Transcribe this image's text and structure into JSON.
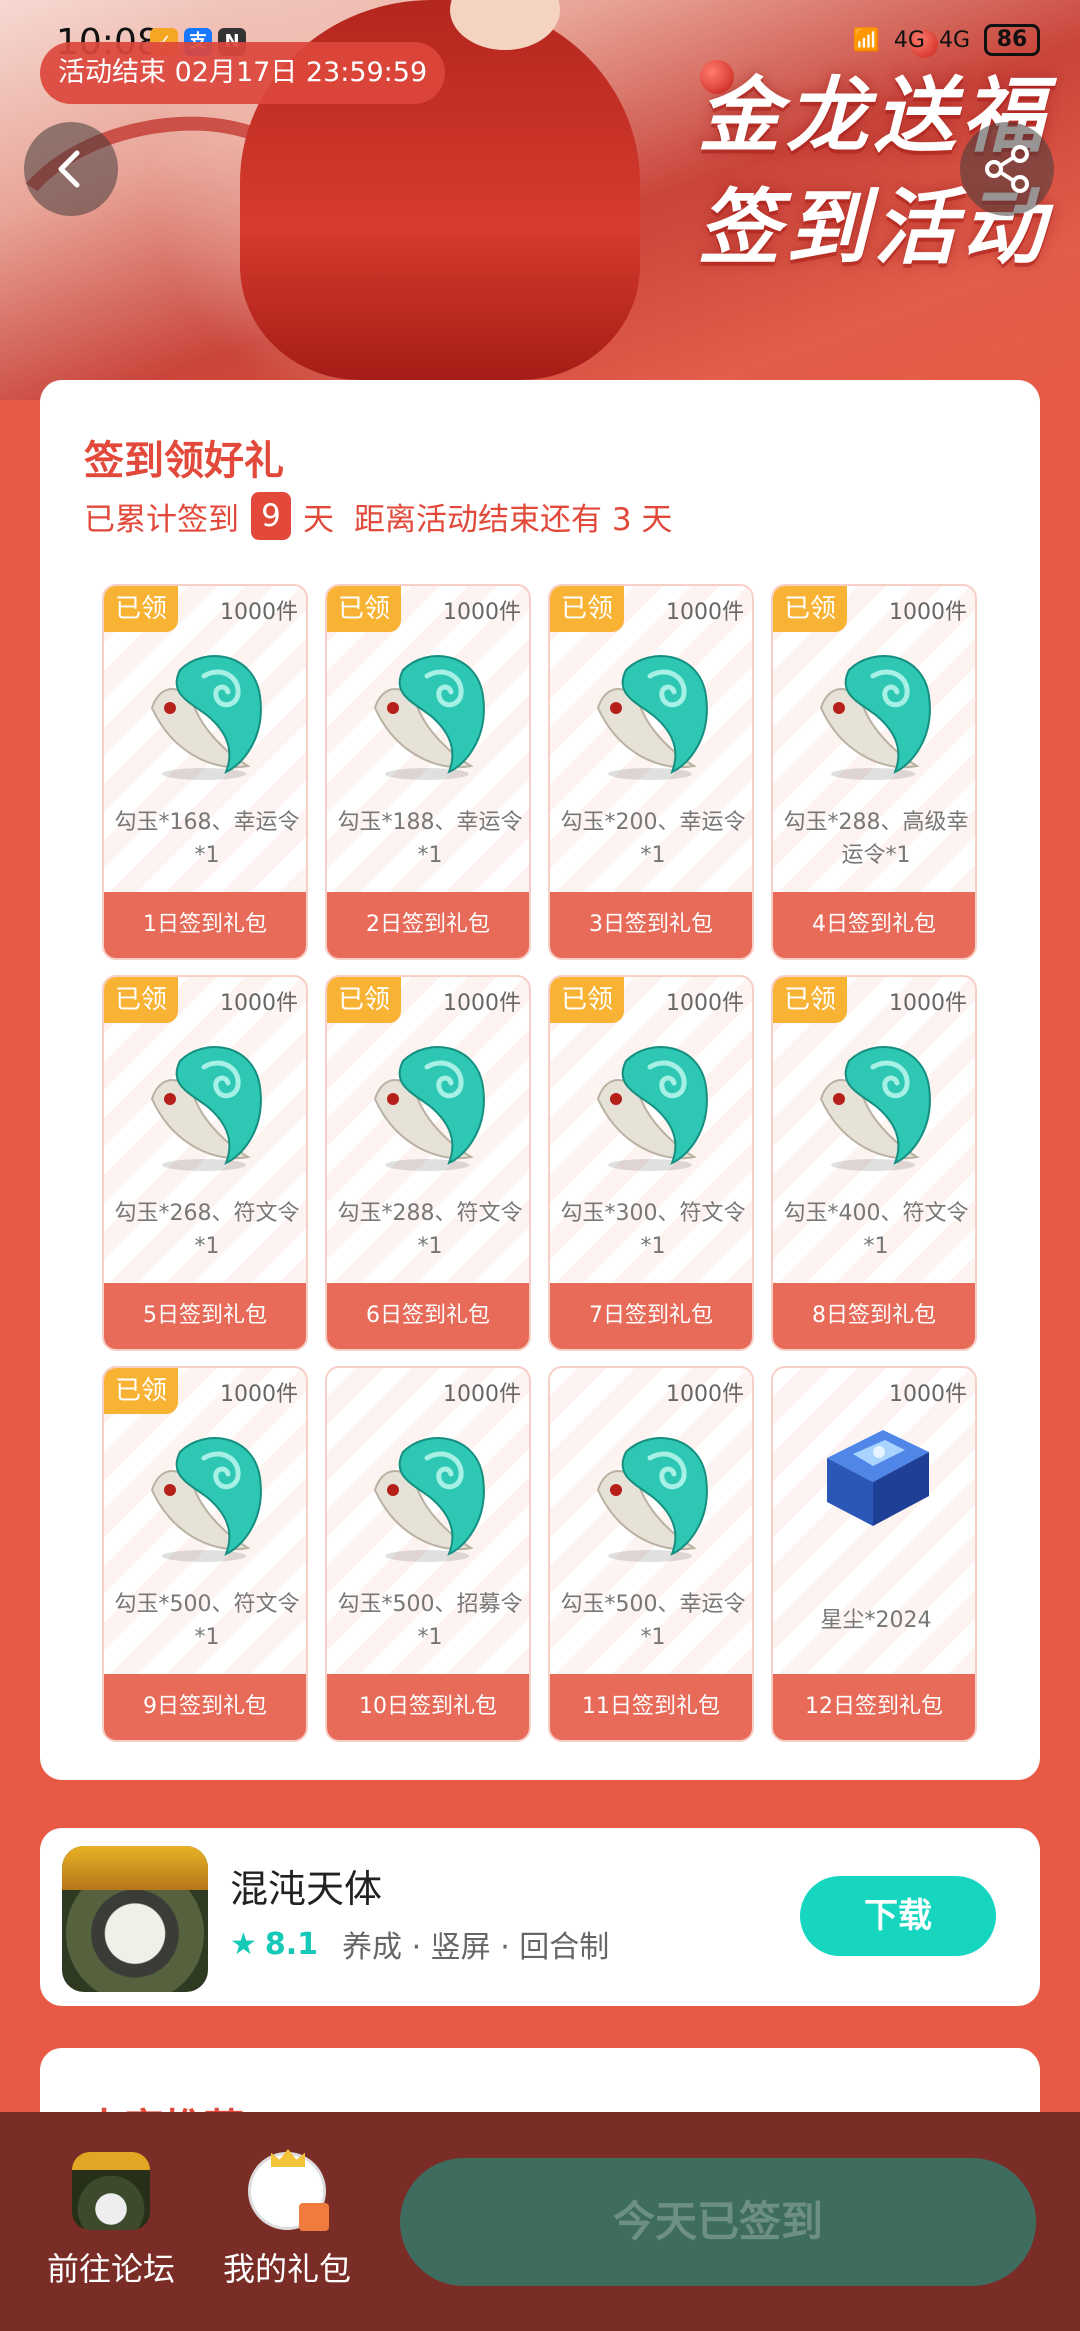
{
  "status_bar": {
    "time": "10:08",
    "network_1": "4G",
    "network_2": "4G",
    "battery": "86"
  },
  "event_end_pill": "活动结束 02月17日 23:59:59",
  "banner": {
    "line1": "金龙送福",
    "line2": "签到活动"
  },
  "signin": {
    "title": "签到领好礼",
    "cumulative_prefix": "已累计签到",
    "days_signed": "9",
    "days_unit": "天",
    "remaining_text": "距离活动结束还有 3 天"
  },
  "gifts": [
    {
      "claimed": "已领",
      "qty": "1000件",
      "desc": "勾玉*168、幸运令*1",
      "label": "1日签到礼包",
      "art": "gouyu-icon"
    },
    {
      "claimed": "已领",
      "qty": "1000件",
      "desc": "勾玉*188、幸运令*1",
      "label": "2日签到礼包",
      "art": "gouyu-icon"
    },
    {
      "claimed": "已领",
      "qty": "1000件",
      "desc": "勾玉*200、幸运令*1",
      "label": "3日签到礼包",
      "art": "gouyu-icon"
    },
    {
      "claimed": "已领",
      "qty": "1000件",
      "desc": "勾玉*288、高级幸运令*1",
      "label": "4日签到礼包",
      "art": "gouyu-icon"
    },
    {
      "claimed": "已领",
      "qty": "1000件",
      "desc": "勾玉*268、符文令*1",
      "label": "5日签到礼包",
      "art": "gouyu-icon"
    },
    {
      "claimed": "已领",
      "qty": "1000件",
      "desc": "勾玉*288、符文令*1",
      "label": "6日签到礼包",
      "art": "gouyu-icon"
    },
    {
      "claimed": "已领",
      "qty": "1000件",
      "desc": "勾玉*300、符文令*1",
      "label": "7日签到礼包",
      "art": "gouyu-icon"
    },
    {
      "claimed": "已领",
      "qty": "1000件",
      "desc": "勾玉*400、符文令*1",
      "label": "8日签到礼包",
      "art": "gouyu-icon"
    },
    {
      "claimed": "已领",
      "qty": "1000件",
      "desc": "勾玉*500、符文令*1",
      "label": "9日签到礼包",
      "art": "gouyu-icon"
    },
    {
      "claimed": "",
      "qty": "1000件",
      "desc": "勾玉*500、招募令*1",
      "label": "10日签到礼包",
      "art": "gouyu-icon"
    },
    {
      "claimed": "",
      "qty": "1000件",
      "desc": "勾玉*500、幸运令*1",
      "label": "11日签到礼包",
      "art": "gouyu-icon"
    },
    {
      "claimed": "",
      "qty": "1000件",
      "desc": "星尘*2024",
      "label": "12日签到礼包",
      "art": "stardust-chest-icon"
    }
  ],
  "game": {
    "name": "混沌天体",
    "rating": "8.1",
    "tags": "养成 · 竖屏 · 回合制",
    "download": "下载"
  },
  "next_section_title": "大家推荐",
  "bottom_bar": {
    "forum": "前往论坛",
    "my_gifts": "我的礼包",
    "signed_button": "今天已签到"
  },
  "colors": {
    "primary_red": "#e2493a",
    "badge_orange": "#f9b334",
    "teal": "#16d6c0",
    "bottom_bg": "#7a2c26",
    "signed_btn": "#3e6d60"
  }
}
